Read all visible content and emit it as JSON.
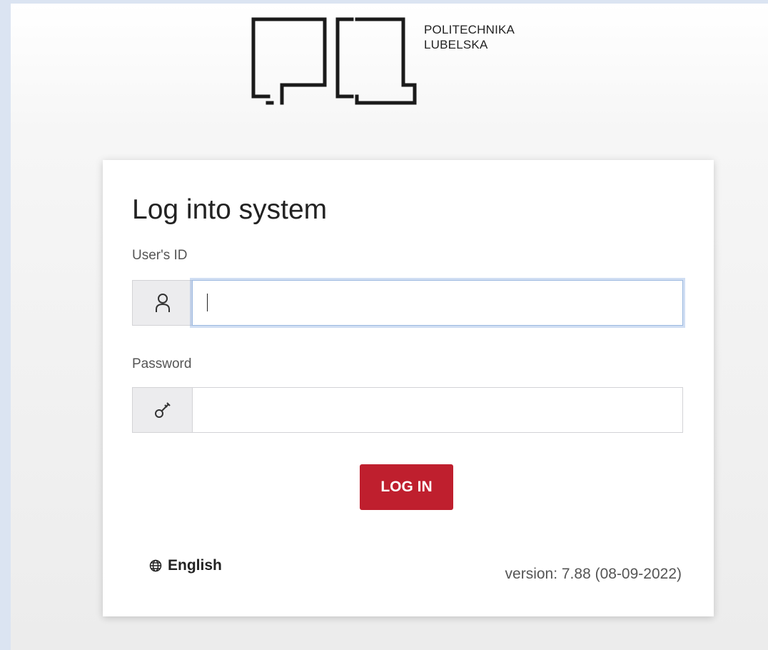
{
  "logo": {
    "line1": "POLITECHNIKA",
    "line2": "LUBELSKA"
  },
  "login": {
    "title": "Log into system",
    "user_id_label": "User's ID",
    "user_id_value": "",
    "password_label": "Password",
    "password_value": "",
    "button_label": "LOG IN"
  },
  "footer": {
    "language": "English",
    "version": "version: 7.88 (08-09-2022)"
  },
  "icons": {
    "user_field": "user-icon",
    "password_field": "key-icon",
    "language": "globe-icon"
  },
  "colors": {
    "accent": "#bf1f2e",
    "focus_border": "#9cb9e0"
  }
}
